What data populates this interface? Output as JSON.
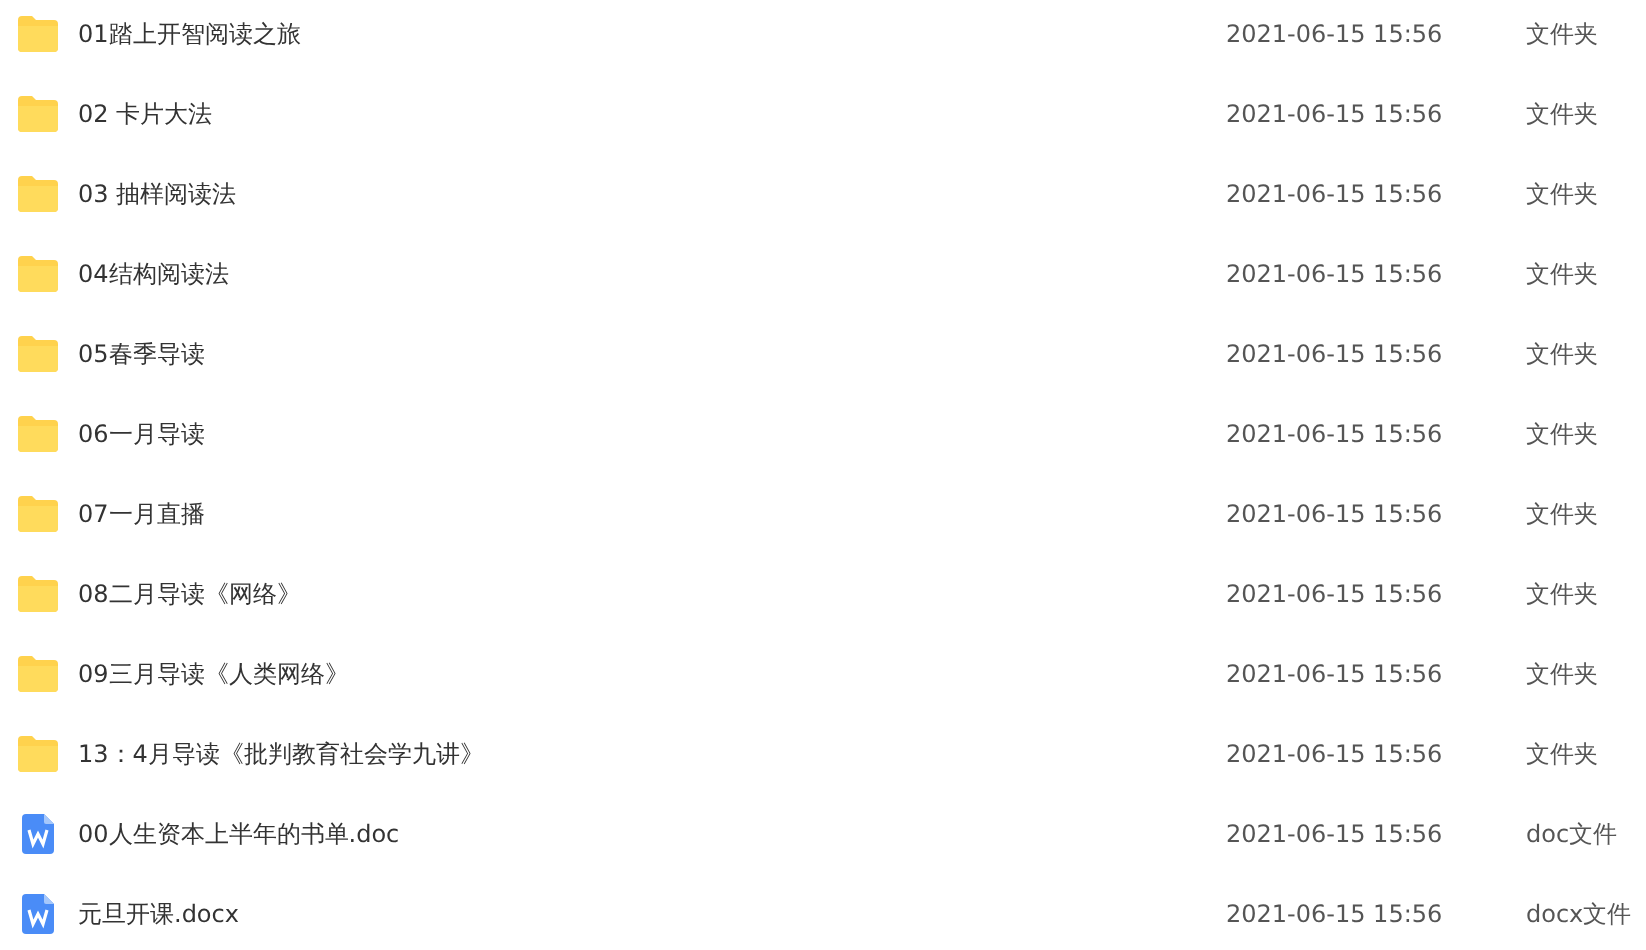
{
  "files": [
    {
      "kind": "folder",
      "name": "01踏上开智阅读之旅",
      "modified": "2021-06-15 15:56",
      "type": "文件夹"
    },
    {
      "kind": "folder",
      "name": "02 卡片大法",
      "modified": "2021-06-15 15:56",
      "type": "文件夹"
    },
    {
      "kind": "folder",
      "name": "03 抽样阅读法",
      "modified": "2021-06-15 15:56",
      "type": "文件夹"
    },
    {
      "kind": "folder",
      "name": "04结构阅读法",
      "modified": "2021-06-15 15:56",
      "type": "文件夹"
    },
    {
      "kind": "folder",
      "name": "05春季导读",
      "modified": "2021-06-15 15:56",
      "type": "文件夹"
    },
    {
      "kind": "folder",
      "name": "06一月导读",
      "modified": "2021-06-15 15:56",
      "type": "文件夹"
    },
    {
      "kind": "folder",
      "name": "07一月直播",
      "modified": "2021-06-15 15:56",
      "type": "文件夹"
    },
    {
      "kind": "folder",
      "name": "08二月导读《网络》",
      "modified": "2021-06-15 15:56",
      "type": "文件夹"
    },
    {
      "kind": "folder",
      "name": "09三月导读《人类网络》",
      "modified": "2021-06-15 15:56",
      "type": "文件夹"
    },
    {
      "kind": "folder",
      "name": "13：4月导读《批判教育社会学九讲》",
      "modified": "2021-06-15 15:56",
      "type": "文件夹"
    },
    {
      "kind": "doc",
      "name": "00人生资本上半年的书单.doc",
      "modified": "2021-06-15 15:56",
      "type": "doc文件"
    },
    {
      "kind": "doc",
      "name": "元旦开课.docx",
      "modified": "2021-06-15 15:56",
      "type": "docx文件"
    }
  ]
}
